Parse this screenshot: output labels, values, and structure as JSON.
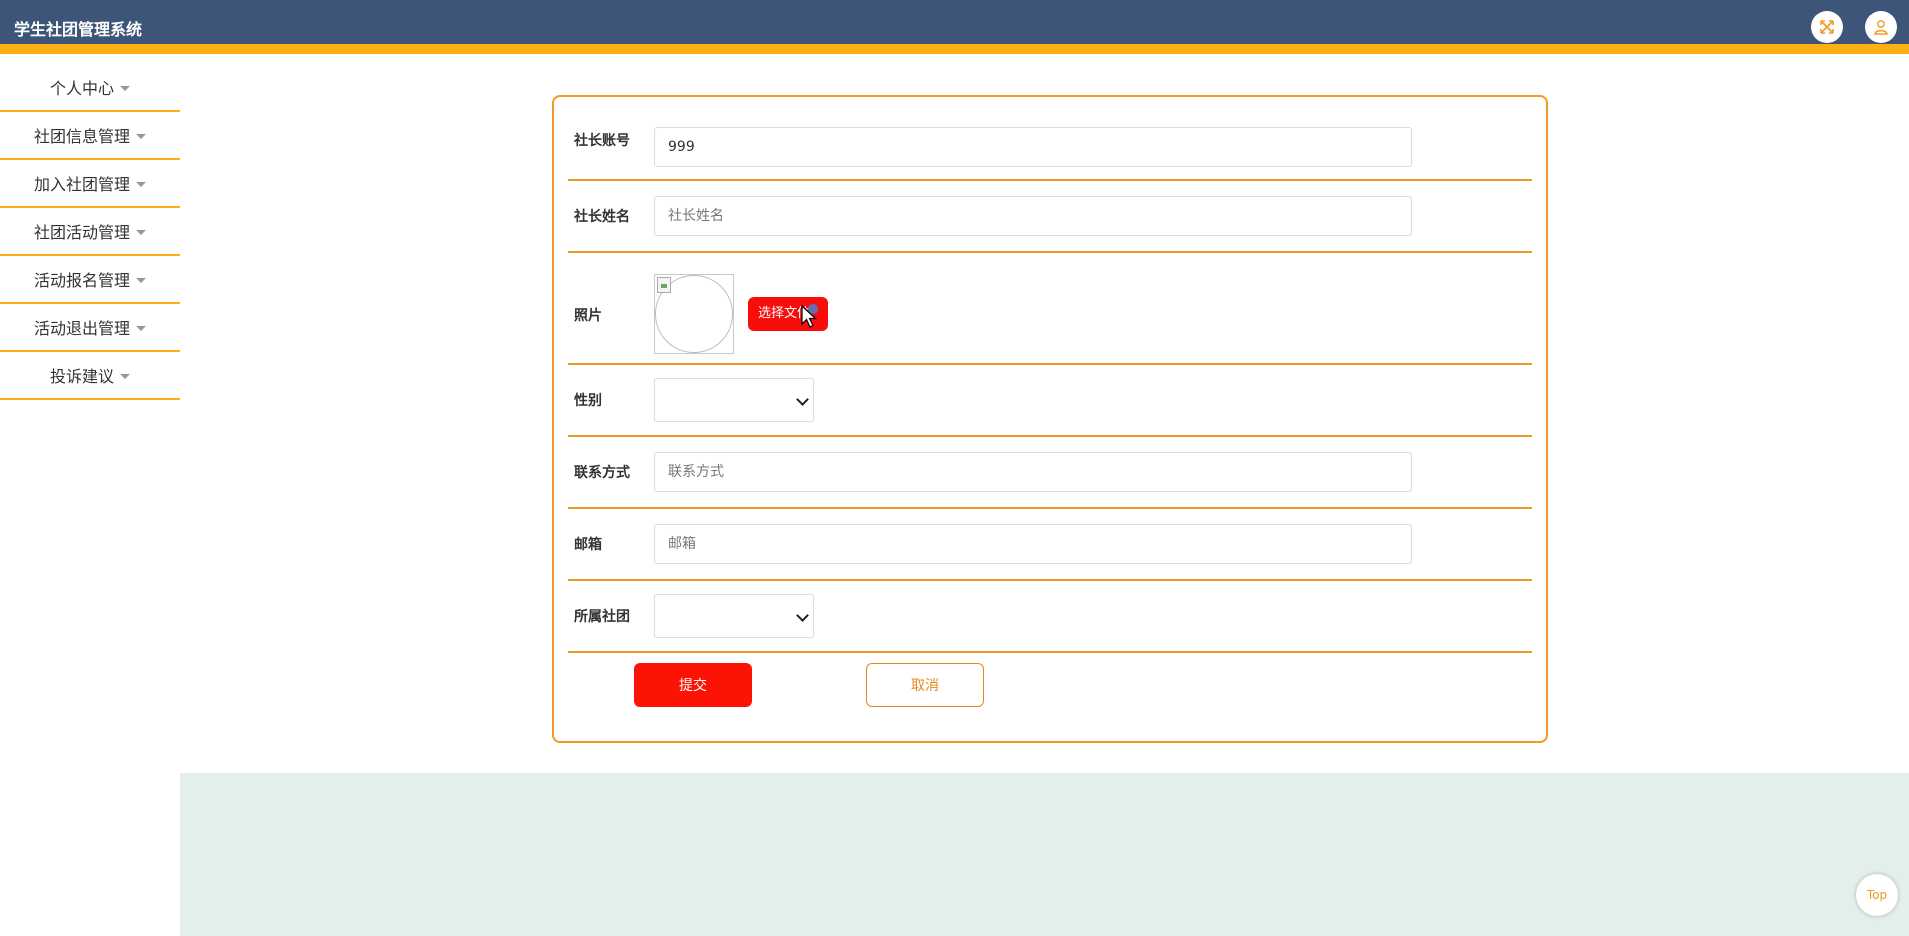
{
  "app": {
    "title": "学生社团管理系统"
  },
  "header": {
    "fullscreen_icon": "expand-arrows-icon",
    "user_icon": "user-icon",
    "icon_color": "#ee9a23"
  },
  "sidebar": {
    "items": [
      {
        "label": "个人中心"
      },
      {
        "label": "社团信息管理"
      },
      {
        "label": "加入社团管理"
      },
      {
        "label": "社团活动管理"
      },
      {
        "label": "活动报名管理"
      },
      {
        "label": "活动退出管理"
      },
      {
        "label": "投诉建议"
      }
    ]
  },
  "form": {
    "fields": {
      "account": {
        "label": "社长账号",
        "value": "999"
      },
      "name": {
        "label": "社长姓名",
        "placeholder": "社长姓名",
        "value": ""
      },
      "photo": {
        "label": "照片",
        "button_label": "选择文件"
      },
      "gender": {
        "label": "性别",
        "selected": ""
      },
      "contact": {
        "label": "联系方式",
        "placeholder": "联系方式",
        "value": ""
      },
      "email": {
        "label": "邮箱",
        "placeholder": "邮箱",
        "value": ""
      },
      "club": {
        "label": "所属社团",
        "selected": ""
      }
    },
    "submit_label": "提交",
    "cancel_label": "取消"
  },
  "footer": {
    "top_label": "Top"
  },
  "colors": {
    "header_bg": "#3d5578",
    "accent": "#fcb013",
    "border": "#ee9a23",
    "submit_bg": "#fb1306",
    "band_bg": "#e3efe9"
  }
}
